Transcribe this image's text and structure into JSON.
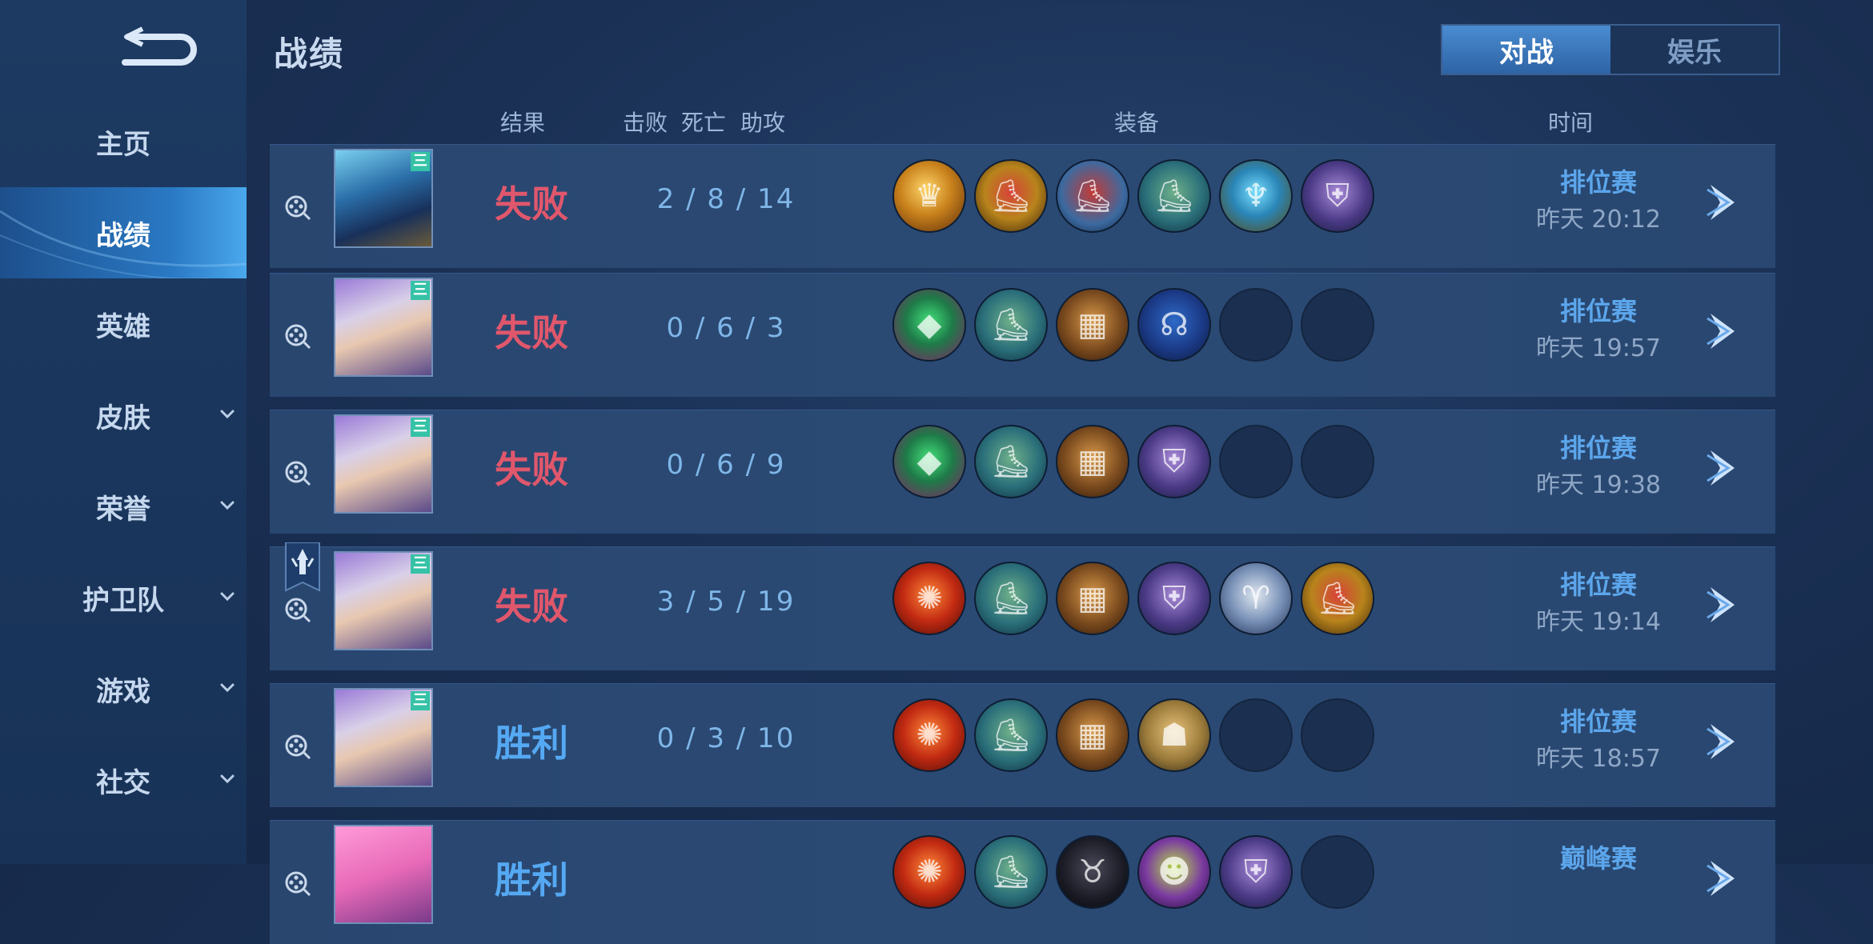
{
  "header": {
    "title": "战绩"
  },
  "tabs": [
    {
      "label": "对战",
      "active": true
    },
    {
      "label": "娱乐",
      "active": false
    }
  ],
  "sidebar": {
    "items": [
      {
        "label": "主页",
        "active": false,
        "expandable": false
      },
      {
        "label": "战绩",
        "active": true,
        "expandable": false
      },
      {
        "label": "英雄",
        "active": false,
        "expandable": false
      },
      {
        "label": "皮肤",
        "active": false,
        "expandable": true
      },
      {
        "label": "荣誉",
        "active": false,
        "expandable": true
      },
      {
        "label": "护卫队",
        "active": false,
        "expandable": true
      },
      {
        "label": "游戏",
        "active": false,
        "expandable": true
      },
      {
        "label": "社交",
        "active": false,
        "expandable": true
      }
    ]
  },
  "columns": {
    "result": "结果",
    "kills": "击败",
    "deaths": "死亡",
    "assists": "助攻",
    "items": "装备",
    "time": "时间"
  },
  "colors": {
    "lose": "#e0576c",
    "win": "#55a8f2",
    "accent": "#3a7ac4"
  },
  "matches": [
    {
      "hero": "armored-blue-hero-portrait",
      "hero_tag": "三",
      "result": "失败",
      "kda": "2 / 8 / 14",
      "items": [
        "gold-mask",
        "red-gold-boots",
        "red-armor-boots",
        "teal-boots",
        "golden-helm",
        "purple-cape"
      ],
      "mode": "排位赛",
      "time": "昨天 20:12",
      "mvp_badge": false
    },
    {
      "hero": "white-haired-hero-portrait",
      "hero_tag": "三",
      "result": "失败",
      "kda": "0 / 6 / 3",
      "items": [
        "green-crystal",
        "teal-boots",
        "bronze-armor",
        "hooded-cloak",
        "",
        ""
      ],
      "mode": "排位赛",
      "time": "昨天 19:57",
      "mvp_badge": false
    },
    {
      "hero": "white-haired-hero-portrait",
      "hero_tag": "三",
      "result": "失败",
      "kda": "0 / 6 / 9",
      "items": [
        "green-crystal",
        "teal-boots",
        "bronze-armor",
        "purple-cape",
        "",
        ""
      ],
      "mode": "排位赛",
      "time": "昨天 19:38",
      "mvp_badge": false
    },
    {
      "hero": "white-haired-hero-portrait",
      "hero_tag": "三",
      "result": "失败",
      "kda": "3 / 5 / 19",
      "items": [
        "red-orb",
        "teal-boots",
        "bronze-armor",
        "purple-cape",
        "silver-ram-shield",
        "red-gold-boots"
      ],
      "mode": "排位赛",
      "time": "昨天 19:14",
      "mvp_badge": true
    },
    {
      "hero": "white-haired-hero-portrait",
      "hero_tag": "三",
      "result": "胜利",
      "kda": "0 / 3 / 10",
      "items": [
        "red-orb",
        "teal-boots",
        "bronze-armor",
        "gold-robe",
        "",
        ""
      ],
      "mode": "排位赛",
      "time": "昨天 18:57",
      "mvp_badge": false
    },
    {
      "hero": "pink-haired-hero-portrait",
      "hero_tag": "",
      "result": "胜利",
      "kda": "",
      "items": [
        "red-orb",
        "teal-boots",
        "black-horns",
        "green-mask",
        "purple-cape",
        ""
      ],
      "mode": "巅峰赛",
      "time": "",
      "mvp_badge": false
    }
  ]
}
